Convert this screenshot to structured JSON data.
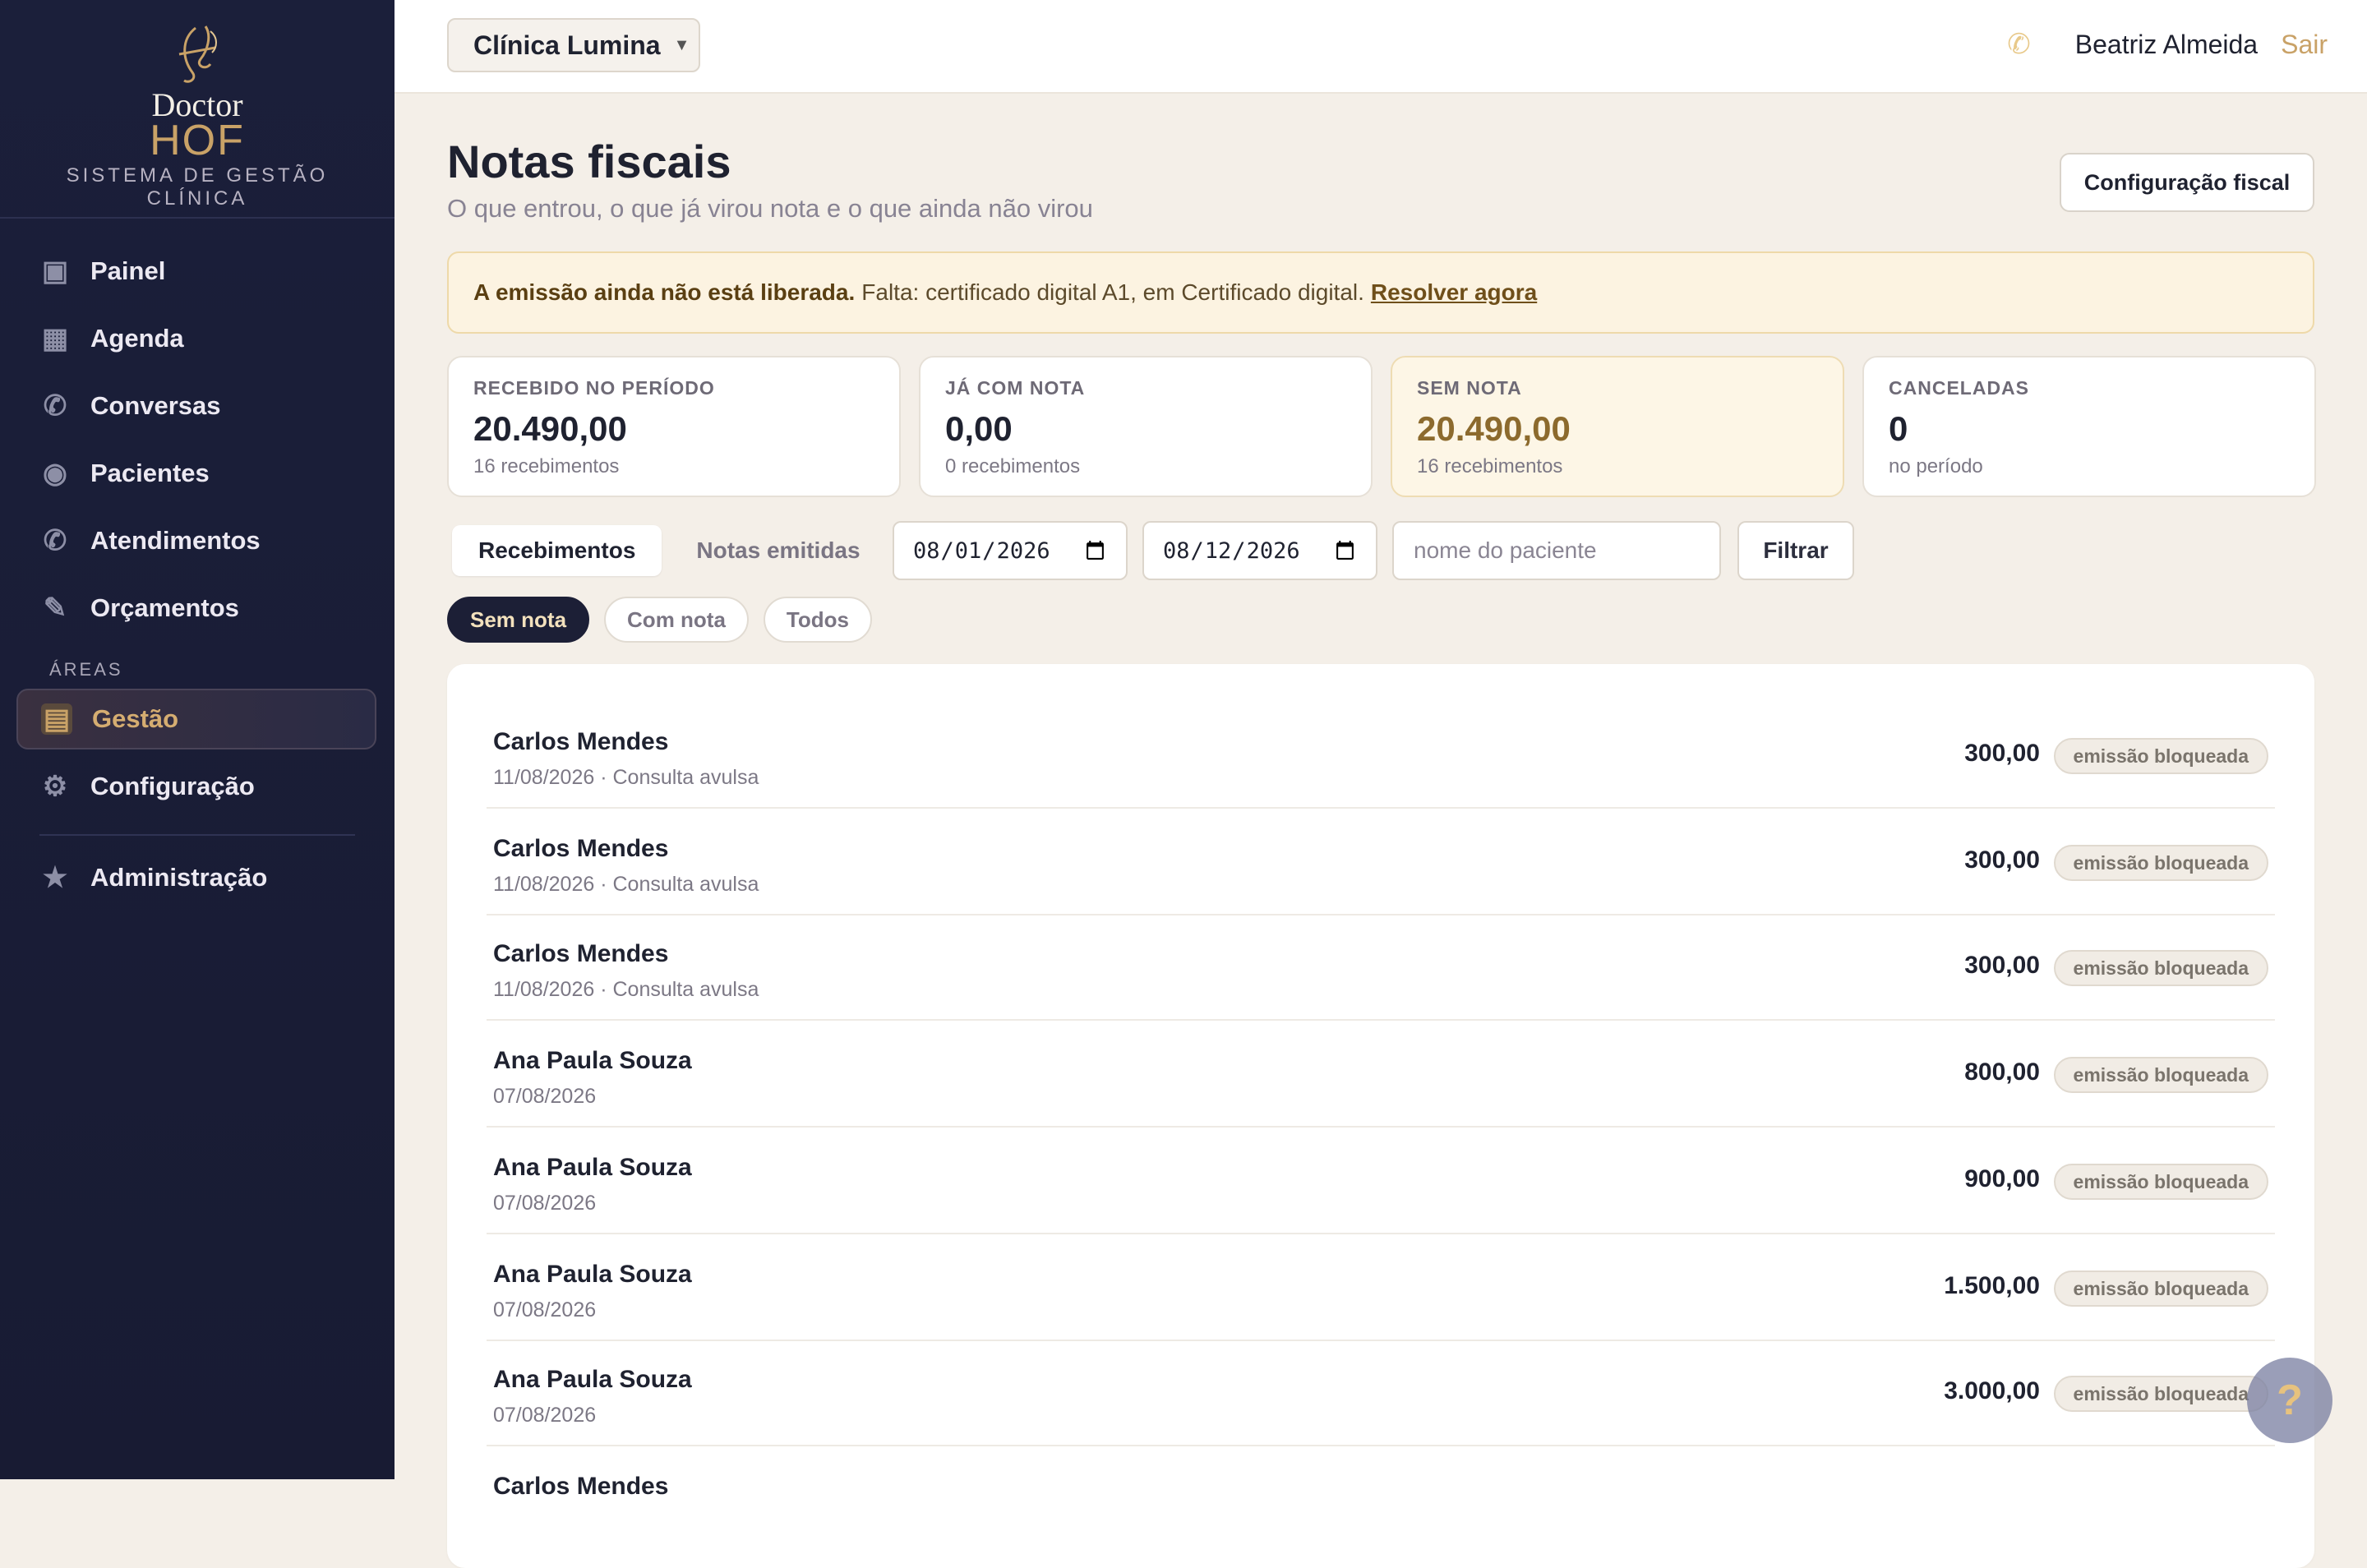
{
  "brand": {
    "name_top": "Doctor",
    "name_bottom": "HOF",
    "subtitle": "SISTEMA DE GESTÃO CLÍNICA"
  },
  "sidebar": {
    "items": [
      {
        "label": "Painel",
        "icon": "panel-icon"
      },
      {
        "label": "Agenda",
        "icon": "calendar-icon"
      },
      {
        "label": "Conversas",
        "icon": "chat-icon"
      },
      {
        "label": "Pacientes",
        "icon": "patients-icon"
      },
      {
        "label": "Atendimentos",
        "icon": "appointments-icon"
      },
      {
        "label": "Orçamentos",
        "icon": "pencil-icon"
      }
    ],
    "section_label": "ÁREAS",
    "area_items": [
      {
        "label": "Gestão",
        "icon": "document-icon",
        "active": true
      },
      {
        "label": "Configuração",
        "icon": "gear-icon"
      }
    ],
    "admin_item": {
      "label": "Administração",
      "icon": "star-icon"
    }
  },
  "topbar": {
    "clinic": "Clínica Lumina",
    "user": "Beatriz Almeida",
    "logout": "Sair"
  },
  "page": {
    "title": "Notas fiscais",
    "subtitle": "O que entrou, o que já virou nota e o que ainda não virou",
    "config_button": "Configuração fiscal"
  },
  "alert": {
    "bold": "A emissão ainda não está liberada.",
    "text": "Falta: certificado digital A1, em Certificado digital.",
    "link": "Resolver agora"
  },
  "stats": [
    {
      "label": "RECEBIDO NO PERÍODO",
      "value": "20.490,00",
      "note": "16 recebimentos"
    },
    {
      "label": "JÁ COM NOTA",
      "value": "0,00",
      "note": "0 recebimentos"
    },
    {
      "label": "SEM NOTA",
      "value": "20.490,00",
      "note": "16 recebimentos"
    },
    {
      "label": "CANCELADAS",
      "value": "0",
      "note": "no período"
    }
  ],
  "tabs": [
    "Recebimentos",
    "Notas emitidas"
  ],
  "filters": {
    "date_from": "2026-08-01",
    "date_to": "2026-08-12",
    "patient_placeholder": "nome do paciente",
    "filter_button": "Filtrar"
  },
  "chips": [
    "Sem nota",
    "Com nota",
    "Todos"
  ],
  "rows": [
    {
      "name": "Carlos Mendes",
      "meta": "11/08/2026 · Consulta avulsa",
      "amount": "300,00",
      "status": "emissão bloqueada"
    },
    {
      "name": "Carlos Mendes",
      "meta": "11/08/2026 · Consulta avulsa",
      "amount": "300,00",
      "status": "emissão bloqueada"
    },
    {
      "name": "Carlos Mendes",
      "meta": "11/08/2026 · Consulta avulsa",
      "amount": "300,00",
      "status": "emissão bloqueada"
    },
    {
      "name": "Ana Paula Souza",
      "meta": "07/08/2026",
      "amount": "800,00",
      "status": "emissão bloqueada"
    },
    {
      "name": "Ana Paula Souza",
      "meta": "07/08/2026",
      "amount": "900,00",
      "status": "emissão bloqueada"
    },
    {
      "name": "Ana Paula Souza",
      "meta": "07/08/2026",
      "amount": "1.500,00",
      "status": "emissão bloqueada"
    },
    {
      "name": "Ana Paula Souza",
      "meta": "07/08/2026",
      "amount": "3.000,00",
      "status": "emissão bloqueada"
    },
    {
      "name": "Carlos Mendes",
      "meta": "",
      "amount": "",
      "status": ""
    }
  ],
  "help": {
    "label": "?"
  }
}
